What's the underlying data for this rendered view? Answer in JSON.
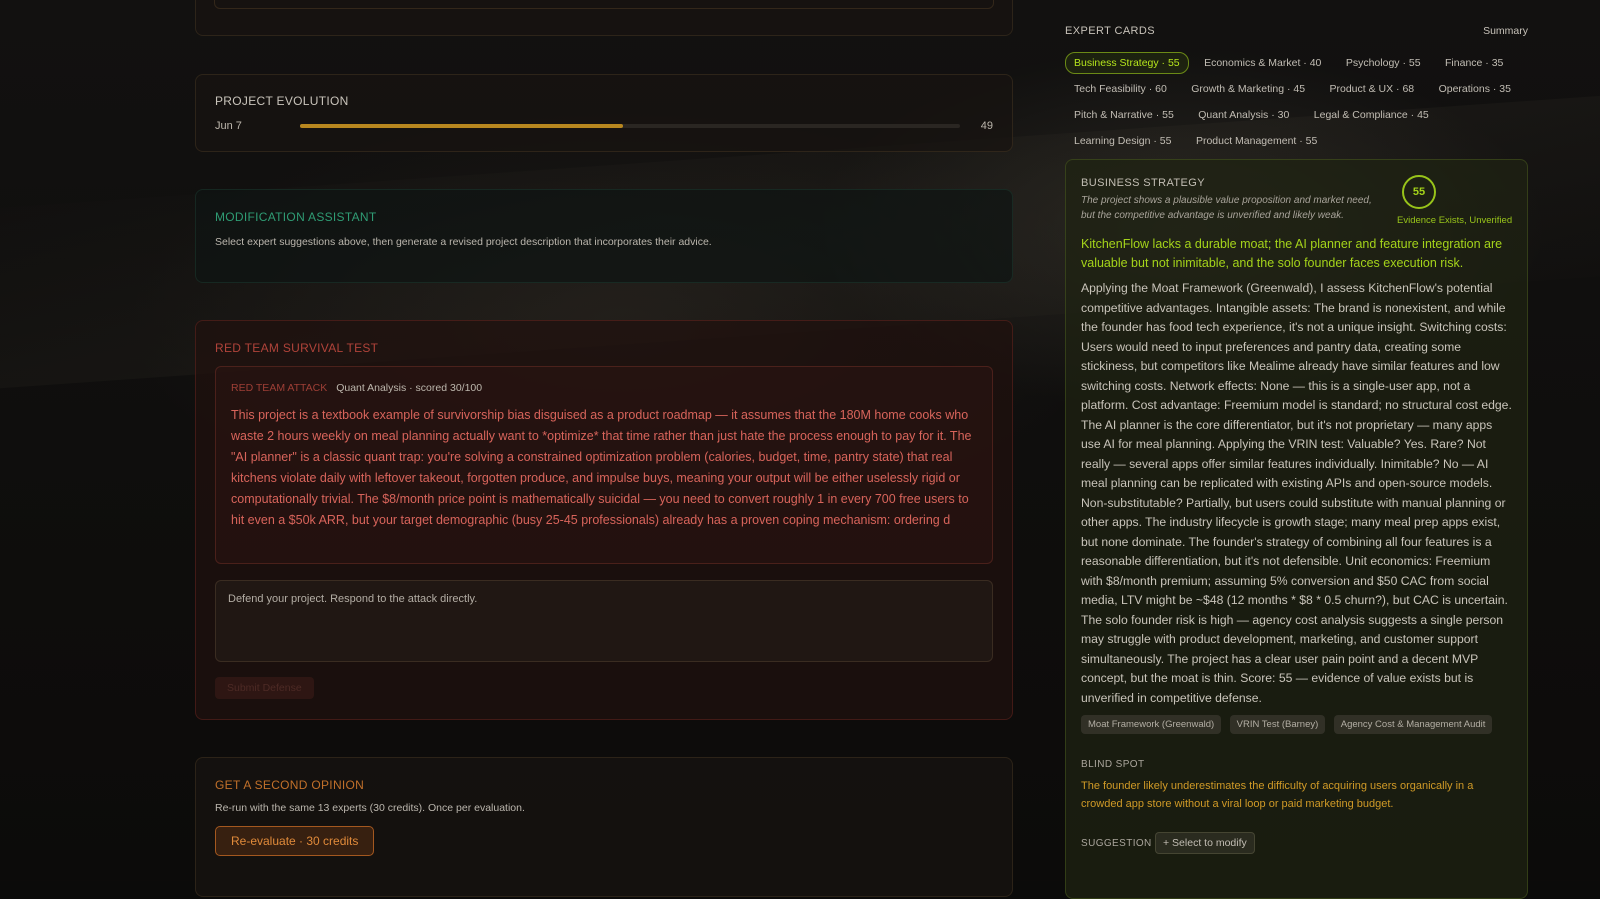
{
  "evolution": {
    "title": "PROJECT EVOLUTION",
    "date": "Jun 7",
    "score": "49",
    "progress_fraction": 0.49
  },
  "modify": {
    "title": "MODIFICATION ASSISTANT",
    "description": "Select expert suggestions above, then generate a revised project description that incorporates their advice."
  },
  "redteam": {
    "title": "RED TEAM SURVIVAL TEST",
    "attack_tag": "RED TEAM ATTACK",
    "attack_meta": "Quant Analysis · scored 30/100",
    "attack_text": "This project is a textbook example of survivorship bias disguised as a product roadmap — it assumes that the 180M home cooks who waste 2 hours weekly on meal planning actually want to *optimize* that time rather than just hate the process enough to pay for it. The \"AI planner\" is a classic quant trap: you're solving a constrained optimization problem (calories, budget, time, pantry state) that real kitchens violate daily with leftover takeout, forgotten produce, and impulse buys, meaning your output will be either uselessly rigid or computationally trivial. The $8/month price point is mathematically suicidal — you need to convert roughly 1 in every 700 free users to hit even a $50k ARR, but your target demographic (busy 25-45 professionals) already has a proven coping mechanism: ordering d",
    "defend_placeholder": "Defend your project. Respond to the attack directly.",
    "submit_label": "Submit Defense"
  },
  "second": {
    "title": "GET A SECOND OPINION",
    "description": "Re-run with the same 13 experts (30 credits). Once per evaluation.",
    "button_label": "Re-evaluate · 30 credits"
  },
  "experts": {
    "title": "EXPERT CARDS",
    "summary_label": "Summary",
    "chips": [
      "Business Strategy · 55",
      "Economics & Market · 40",
      "Psychology · 55",
      "Finance · 35",
      "Tech Feasibility · 60",
      "Growth & Marketing · 45",
      "Product & UX · 68",
      "Operations · 35",
      "Pitch & Narrative · 55",
      "Quant Analysis · 30",
      "Legal & Compliance · 45",
      "Learning Design · 55",
      "Product Management · 55"
    ]
  },
  "detail": {
    "title": "BUSINESS STRATEGY",
    "subtitle": "The project shows a plausible value proposition and market need, but the competitive advantage is unverified and likely weak.",
    "score": "55",
    "verdict": "Evidence Exists, Unverified",
    "headline": "KitchenFlow lacks a durable moat; the AI planner and feature integration are valuable but not inimitable, and the solo founder faces execution risk.",
    "analysis": "Applying the Moat Framework (Greenwald), I assess KitchenFlow's potential competitive advantages. Intangible assets: The brand is nonexistent, and while the founder has food tech experience, it's not a unique insight. Switching costs: Users would need to input preferences and pantry data, creating some stickiness, but competitors like Mealime already have similar features and low switching costs. Network effects: None — this is a single-user app, not a platform. Cost advantage: Freemium model is standard; no structural cost edge. The AI planner is the core differentiator, but it's not proprietary — many apps use AI for meal planning. Applying the VRIN test: Valuable? Yes. Rare? Not really — several apps offer similar features individually. Inimitable? No — AI meal planning can be replicated with existing APIs and open-source models. Non-substitutable? Partially, but users could substitute with manual planning or other apps. The industry lifecycle is growth stage; many meal prep apps exist, but none dominate. The founder's strategy of combining all four features is a reasonable differentiation, but it's not defensible. Unit economics: Freemium with $8/month premium; assuming 5% conversion and $50 CAC from social media, LTV might be ~$48 (12 months * $8 * 0.5 churn?), but CAC is uncertain. The solo founder risk is high — agency cost analysis suggests a single person may struggle with product development, marketing, and customer support simultaneously. The project has a clear user pain point and a decent MVP concept, but the moat is thin. Score: 55 — evidence of value exists but is unverified in competitive defense.",
    "frameworks": [
      "Moat Framework (Greenwald)",
      "VRIN Test (Barney)",
      "Agency Cost & Management Audit"
    ],
    "blind_spot_title": "BLIND SPOT",
    "blind_spot_text": "The founder likely underestimates the difficulty of acquiring users organically in a crowded app store without a viral loop or paid marketing budget.",
    "suggestion_title": "SUGGESTION",
    "select_label": "+ Select to modify"
  },
  "colors": {
    "accent_green": "#a4d31a",
    "accent_red": "#d8645b",
    "accent_orange": "#e08a3a",
    "accent_teal": "#2f9c74",
    "accent_gold": "#b8871f"
  }
}
